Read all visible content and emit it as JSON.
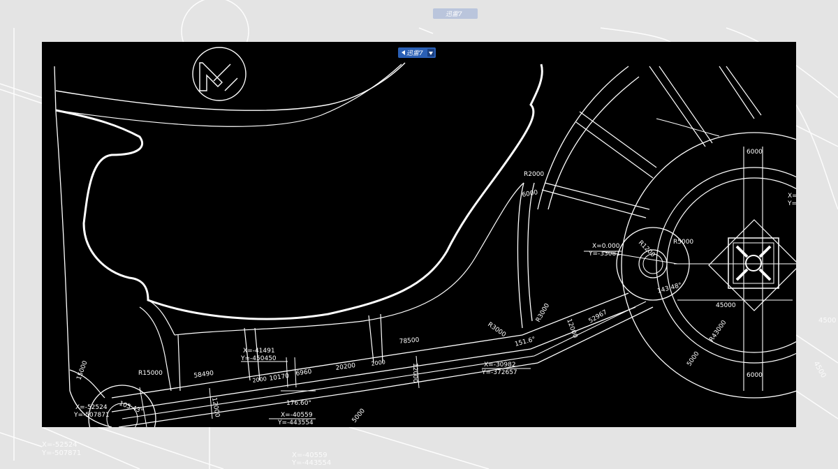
{
  "watermark": {
    "text": "迅雷7"
  },
  "compass": {
    "symbol": "N"
  },
  "annotations": {
    "r2000": "R2000",
    "d6000_a": "6000",
    "d6000_top": "6000",
    "d6000_bottom": "6000",
    "coord_center_x": "X=0.000",
    "coord_center_y": "Y=-33081",
    "r1200": "R1200",
    "r5000": "R5000",
    "angle_143": "143.48°",
    "d45000": "45000",
    "r43000": "R43000",
    "d5000": "5000",
    "r3000_a": "R3000",
    "r3000_b": "R3000",
    "d52967": "52967",
    "d12000_a": "12000",
    "angle_151": "151.6°",
    "d78500": "78500",
    "coord_mid_x": "X=-30982",
    "coord_mid_y": "Y=-372657",
    "d12000_b": "12000",
    "coord_left_x": "X=-41491",
    "coord_left_y": "Y=-450450",
    "d58490": "58490",
    "d2000_a": "2000",
    "d10170": "10170",
    "d6960": "6960",
    "d20200": "20200",
    "d2000_b": "2000",
    "r15000": "R15000",
    "d15000": "15000",
    "coord_bl_x": "X=-52524",
    "coord_bl_y": "Y=-507871",
    "angle_105": "105.43°",
    "d12000_c": "12000",
    "angle_176": "176.60°",
    "coord_b_x": "X=-40559",
    "coord_b_y": "Y=-443554",
    "d5000_b": "5000",
    "right_x": "X=",
    "right_y": "Y="
  },
  "background": {
    "d4500": "4500",
    "d4500b": "4500",
    "coord_x": "X=-52524",
    "coord_y": "Y=-507871",
    "coord_b_x": "X=-40559",
    "coord_b_y": "Y=-443554"
  },
  "colors": {
    "canvas": "#000000",
    "line": "#ffffff",
    "page_bg": "#e4e4e4",
    "badge": "#2a5fb4"
  }
}
